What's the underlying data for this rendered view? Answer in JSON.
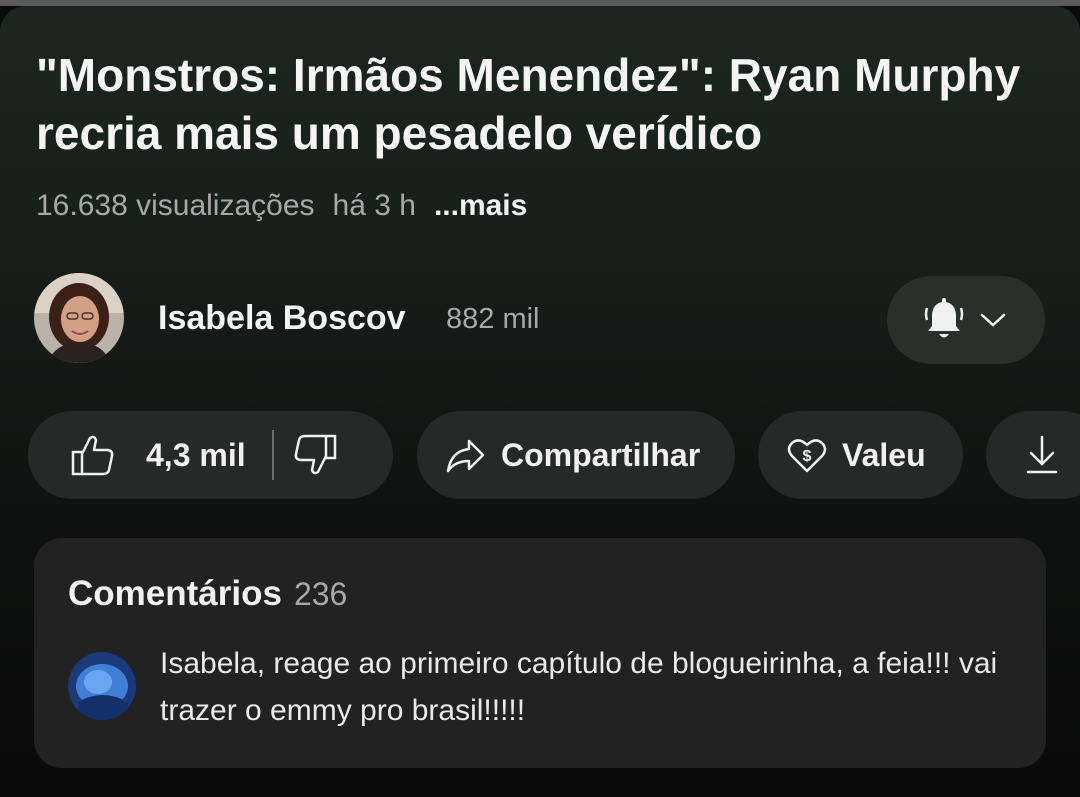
{
  "video": {
    "title": "\"Monstros: Irmãos Menendez\": Ryan Murphy recria mais um pesadelo verídico",
    "views": "16.638 visualizações",
    "age": "há 3 h",
    "more_label": "...mais"
  },
  "channel": {
    "name": "Isabela Boscov",
    "subscribers": "882 mil",
    "avatar_icon": "channel-avatar-photo",
    "bell_icon": "bell-icon",
    "chevron_icon": "chevron-down-icon"
  },
  "actions": {
    "like_count": "4,3 mil",
    "like_icon": "thumbs-up-icon",
    "dislike_icon": "thumbs-down-icon",
    "share_label": "Compartilhar",
    "share_icon": "share-arrow-icon",
    "thanks_label": "Valeu",
    "thanks_icon": "heart-dollar-icon",
    "download_icon": "download-icon"
  },
  "comments": {
    "heading": "Comentários",
    "count": "236",
    "top_comment": {
      "text": "Isabela, reage ao primeiro capítulo de blogueirinha, a feia!!! vai trazer o emmy pro brasil!!!!!",
      "avatar_icon": "commenter-avatar"
    }
  },
  "colors": {
    "panel_top": "#1c2620",
    "pill_bg": "#262928",
    "comments_bg": "#222222",
    "secondary_text": "#a8a8a8"
  }
}
